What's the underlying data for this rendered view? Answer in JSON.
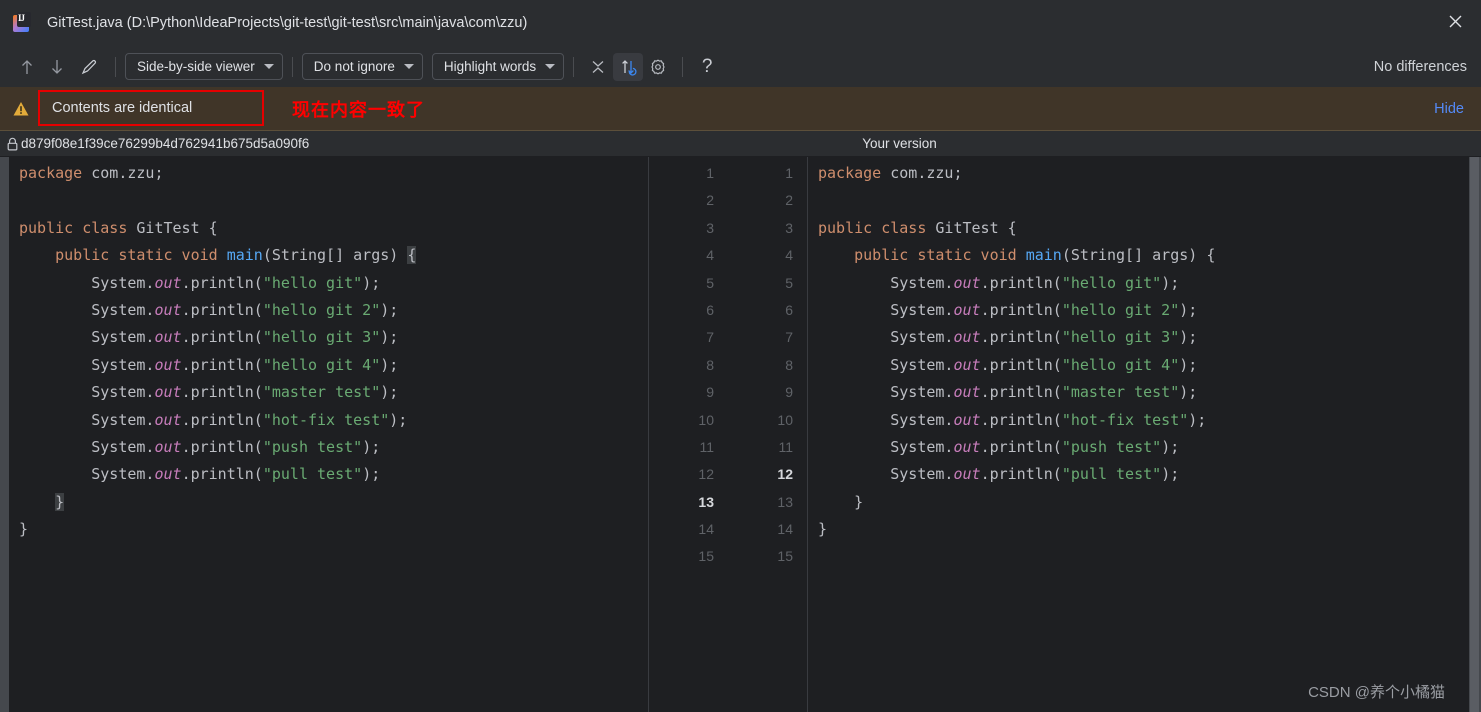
{
  "window": {
    "title": "GitTest.java (D:\\Python\\IdeaProjects\\git-test\\git-test\\src\\main\\java\\com\\zzu)",
    "app_icon": "intellij-idea-icon",
    "close_icon": "close-icon",
    "icon_label": "IJ"
  },
  "toolbar": {
    "prev_diff_icon": "arrow-up-icon",
    "next_diff_icon": "arrow-down-icon",
    "edit_icon": "pencil-icon",
    "viewer_mode": "Side-by-side viewer",
    "ignore_mode": "Do not ignore",
    "highlight_mode": "Highlight words",
    "collapse_icon": "collapse-unchanged-icon",
    "sync_icon": "synchronize-scroll-icon",
    "settings_icon": "gear-icon",
    "help_icon": "question-mark-icon",
    "status": "No differences"
  },
  "notification": {
    "warning_icon": "warning-triangle-icon",
    "message": "Contents are identical",
    "annotation": "现在内容一致了",
    "annotation_color": "#ff0000",
    "hide_label": "Hide",
    "hide_color": "#548af7",
    "background": "#403528"
  },
  "panes": {
    "left_header": "d879f08e1f39ce76299b4d762941b675d5a090f6",
    "left_header_icon": "lock-icon",
    "right_header": "Your version"
  },
  "gutter": {
    "left_numbers": [
      "1",
      "2",
      "3",
      "4",
      "5",
      "6",
      "7",
      "8",
      "9",
      "10",
      "11",
      "12",
      "13",
      "14",
      "15"
    ],
    "right_numbers": [
      "1",
      "2",
      "3",
      "4",
      "5",
      "6",
      "7",
      "8",
      "9",
      "10",
      "11",
      "12",
      "13",
      "14",
      "15"
    ],
    "left_current_index": 12,
    "right_current_index": 11
  },
  "code": {
    "language": "java",
    "lines": [
      "package com.zzu;",
      "",
      "public class GitTest {",
      "    public static void main(String[] args) {",
      "        System.out.println(\"hello git\");",
      "        System.out.println(\"hello git 2\");",
      "        System.out.println(\"hello git 3\");",
      "        System.out.println(\"hello git 4\");",
      "        System.out.println(\"master test\");",
      "        System.out.println(\"hot-fix test\");",
      "        System.out.println(\"push test\");",
      "        System.out.println(\"pull test\");",
      "    }",
      "}",
      ""
    ],
    "left_tokens": [
      [
        {
          "t": "package",
          "c": "kw"
        },
        {
          "t": " com.zzu;",
          "c": "id"
        }
      ],
      [],
      [
        {
          "t": "public class",
          "c": "kw"
        },
        {
          "t": " GitTest {",
          "c": "id"
        }
      ],
      [
        {
          "t": "    ",
          "c": "id"
        },
        {
          "t": "public static void",
          "c": "kw"
        },
        {
          "t": " ",
          "c": "id"
        },
        {
          "t": "main",
          "c": "mth"
        },
        {
          "t": "(String[] args) ",
          "c": "id"
        },
        {
          "t": "{",
          "c": "brace"
        }
      ],
      [
        {
          "t": "        System.",
          "c": "id"
        },
        {
          "t": "out",
          "c": "fld"
        },
        {
          "t": ".println(",
          "c": "id"
        },
        {
          "t": "\"hello git\"",
          "c": "str"
        },
        {
          "t": ");",
          "c": "id"
        }
      ],
      [
        {
          "t": "        System.",
          "c": "id"
        },
        {
          "t": "out",
          "c": "fld"
        },
        {
          "t": ".println(",
          "c": "id"
        },
        {
          "t": "\"hello git 2\"",
          "c": "str"
        },
        {
          "t": ");",
          "c": "id"
        }
      ],
      [
        {
          "t": "        System.",
          "c": "id"
        },
        {
          "t": "out",
          "c": "fld"
        },
        {
          "t": ".println(",
          "c": "id"
        },
        {
          "t": "\"hello git 3\"",
          "c": "str"
        },
        {
          "t": ");",
          "c": "id"
        }
      ],
      [
        {
          "t": "        System.",
          "c": "id"
        },
        {
          "t": "out",
          "c": "fld"
        },
        {
          "t": ".println(",
          "c": "id"
        },
        {
          "t": "\"hello git 4\"",
          "c": "str"
        },
        {
          "t": ");",
          "c": "id"
        }
      ],
      [
        {
          "t": "        System.",
          "c": "id"
        },
        {
          "t": "out",
          "c": "fld"
        },
        {
          "t": ".println(",
          "c": "id"
        },
        {
          "t": "\"master test\"",
          "c": "str"
        },
        {
          "t": ");",
          "c": "id"
        }
      ],
      [
        {
          "t": "        System.",
          "c": "id"
        },
        {
          "t": "out",
          "c": "fld"
        },
        {
          "t": ".println(",
          "c": "id"
        },
        {
          "t": "\"hot-fix test\"",
          "c": "str"
        },
        {
          "t": ");",
          "c": "id"
        }
      ],
      [
        {
          "t": "        System.",
          "c": "id"
        },
        {
          "t": "out",
          "c": "fld"
        },
        {
          "t": ".println(",
          "c": "id"
        },
        {
          "t": "\"push test\"",
          "c": "str"
        },
        {
          "t": ");",
          "c": "id"
        }
      ],
      [
        {
          "t": "        System.",
          "c": "id"
        },
        {
          "t": "out",
          "c": "fld"
        },
        {
          "t": ".println(",
          "c": "id"
        },
        {
          "t": "\"pull test\"",
          "c": "str"
        },
        {
          "t": ");",
          "c": "id"
        }
      ],
      [
        {
          "t": "    ",
          "c": "id"
        },
        {
          "t": "}",
          "c": "brace"
        }
      ],
      [
        {
          "t": "}",
          "c": "id"
        }
      ],
      []
    ],
    "right_tokens": [
      [
        {
          "t": "package",
          "c": "kw"
        },
        {
          "t": " com.zzu;",
          "c": "id"
        }
      ],
      [],
      [
        {
          "t": "public class",
          "c": "kw"
        },
        {
          "t": " GitTest {",
          "c": "id"
        }
      ],
      [
        {
          "t": "    ",
          "c": "id"
        },
        {
          "t": "public static void",
          "c": "kw"
        },
        {
          "t": " ",
          "c": "id"
        },
        {
          "t": "main",
          "c": "mth"
        },
        {
          "t": "(String[] args) {",
          "c": "id"
        }
      ],
      [
        {
          "t": "        System.",
          "c": "id"
        },
        {
          "t": "out",
          "c": "fld"
        },
        {
          "t": ".println(",
          "c": "id"
        },
        {
          "t": "\"hello git\"",
          "c": "str"
        },
        {
          "t": ");",
          "c": "id"
        }
      ],
      [
        {
          "t": "        System.",
          "c": "id"
        },
        {
          "t": "out",
          "c": "fld"
        },
        {
          "t": ".println(",
          "c": "id"
        },
        {
          "t": "\"hello git 2\"",
          "c": "str"
        },
        {
          "t": ");",
          "c": "id"
        }
      ],
      [
        {
          "t": "        System.",
          "c": "id"
        },
        {
          "t": "out",
          "c": "fld"
        },
        {
          "t": ".println(",
          "c": "id"
        },
        {
          "t": "\"hello git 3\"",
          "c": "str"
        },
        {
          "t": ");",
          "c": "id"
        }
      ],
      [
        {
          "t": "        System.",
          "c": "id"
        },
        {
          "t": "out",
          "c": "fld"
        },
        {
          "t": ".println(",
          "c": "id"
        },
        {
          "t": "\"hello git 4\"",
          "c": "str"
        },
        {
          "t": ");",
          "c": "id"
        }
      ],
      [
        {
          "t": "        System.",
          "c": "id"
        },
        {
          "t": "out",
          "c": "fld"
        },
        {
          "t": ".println(",
          "c": "id"
        },
        {
          "t": "\"master test\"",
          "c": "str"
        },
        {
          "t": ");",
          "c": "id"
        }
      ],
      [
        {
          "t": "        System.",
          "c": "id"
        },
        {
          "t": "out",
          "c": "fld"
        },
        {
          "t": ".println(",
          "c": "id"
        },
        {
          "t": "\"hot-fix test\"",
          "c": "str"
        },
        {
          "t": ");",
          "c": "id"
        }
      ],
      [
        {
          "t": "        System.",
          "c": "id"
        },
        {
          "t": "out",
          "c": "fld"
        },
        {
          "t": ".println(",
          "c": "id"
        },
        {
          "t": "\"push test\"",
          "c": "str"
        },
        {
          "t": ");",
          "c": "id"
        }
      ],
      [
        {
          "t": "        System.",
          "c": "id"
        },
        {
          "t": "out",
          "c": "fld"
        },
        {
          "t": ".println(",
          "c": "id"
        },
        {
          "t": "\"pull test\"",
          "c": "str"
        },
        {
          "t": ");",
          "c": "id"
        }
      ],
      [
        {
          "t": "    ",
          "c": "id"
        },
        {
          "t": "}",
          "c": "id"
        }
      ],
      [
        {
          "t": "}",
          "c": "id"
        }
      ],
      []
    ]
  },
  "watermark": "CSDN @养个小橘猫",
  "colors": {
    "editor_bg": "#1e1f22",
    "chrome_bg": "#2b2d30",
    "keyword": "#cf8e6d",
    "string": "#6aab73",
    "method": "#56a8f5",
    "field": "#c77dbb",
    "text": "#bcbec4"
  }
}
